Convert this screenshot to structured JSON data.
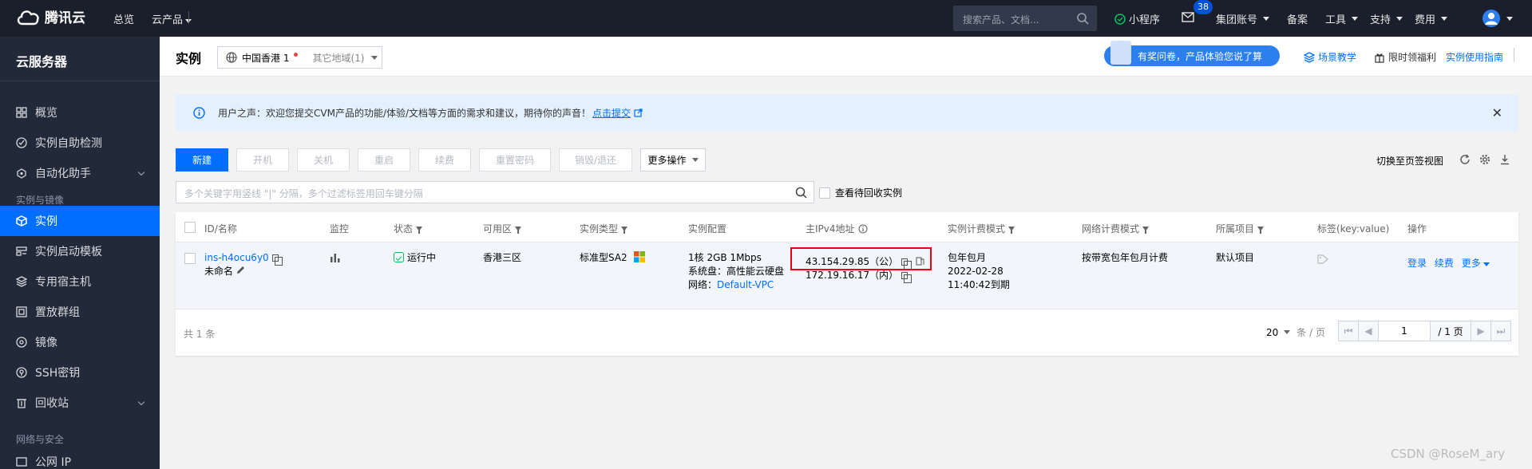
{
  "topbar": {
    "logo_text": "腾讯云",
    "nav_overview": "总览",
    "nav_products": "云产品",
    "search_placeholder": "搜索产品、文档...",
    "mini_program": "小程序",
    "mail_badge": "38",
    "group_account": "集团账号",
    "beian": "备案",
    "tools": "工具",
    "support": "支持",
    "billing": "费用"
  },
  "sidebar": {
    "title": "云服务器",
    "items": [
      {
        "label": "概览",
        "icon": "grid-icon"
      },
      {
        "label": "实例自助检测",
        "icon": "check-circle-icon"
      },
      {
        "label": "自动化助手",
        "icon": "robot-icon"
      }
    ],
    "group_instances": "实例与镜像",
    "instance_items": [
      {
        "label": "实例",
        "icon": "cube-icon",
        "active": true
      },
      {
        "label": "实例启动模板",
        "icon": "template-icon"
      },
      {
        "label": "专用宿主机",
        "icon": "host-icon"
      },
      {
        "label": "置放群组",
        "icon": "group-icon"
      },
      {
        "label": "镜像",
        "icon": "image-icon"
      },
      {
        "label": "SSH密钥",
        "icon": "key-icon"
      },
      {
        "label": "回收站",
        "icon": "trash-icon"
      }
    ],
    "group_network": "网络与安全",
    "network_items": [
      {
        "label": "公网 IP",
        "icon": "ip-icon"
      }
    ]
  },
  "header": {
    "title": "实例",
    "region": "中国香港 1",
    "other_region": "其它地域(1)",
    "promo": "有奖问卷，产品体验您说了算",
    "scene_teaching": "场景教学",
    "limited_welfare": "限时领福利",
    "guide": "实例使用指南"
  },
  "notice": {
    "text": "用户之声：欢迎您提交CVM产品的功能/体验/文档等方面的需求和建议，期待你的声音！",
    "link": "点击提交"
  },
  "toolbar": {
    "new": "新建",
    "start": "开机",
    "stop": "关机",
    "restart": "重启",
    "renew": "续费",
    "reset_password": "重置密码",
    "destroy": "销毁/退还",
    "more": "更多操作",
    "switch_view": "切换至页签视图"
  },
  "filter": {
    "placeholder": "多个关键字用竖线 \"|\" 分隔，多个过滤标签用回车键分隔",
    "show_recycle": "查看待回收实例"
  },
  "table": {
    "headers": {
      "id_name": "ID/名称",
      "monitor": "监控",
      "status": "状态",
      "zone": "可用区",
      "type": "实例类型",
      "config": "实例配置",
      "ipv4": "主IPv4地址",
      "billing_mode": "实例计费模式",
      "network_billing": "网络计费模式",
      "project": "所属项目",
      "tags": "标签(key:value)",
      "actions": "操作"
    },
    "row": {
      "id": "ins-h4ocu6y0",
      "name": "未命名",
      "status": "运行中",
      "zone": "香港三区",
      "type": "标准型SA2",
      "config_line1": "1核 2GB 1Mbps",
      "config_line2": "系统盘：高性能云硬盘",
      "config_line3_label": "网络：",
      "config_line3_vpc": "Default-VPC",
      "public_ip": "43.154.29.85（公）",
      "private_ip": "172.19.16.17（内）",
      "billing_line1": "包年包月",
      "billing_line2": "2022-02-28",
      "billing_line3": "11:40:42到期",
      "network_billing": "按带宽包年包月计费",
      "project": "默认项目",
      "action_login": "登录",
      "action_renew": "续费",
      "action_more": "更多"
    },
    "footer": {
      "count": "共 1 条",
      "page_size": "20",
      "page_size_unit": "条 / 页",
      "page_value": "1",
      "total_pages": "/ 1 页"
    }
  },
  "watermark": "CSDN @RoseM_ary"
}
